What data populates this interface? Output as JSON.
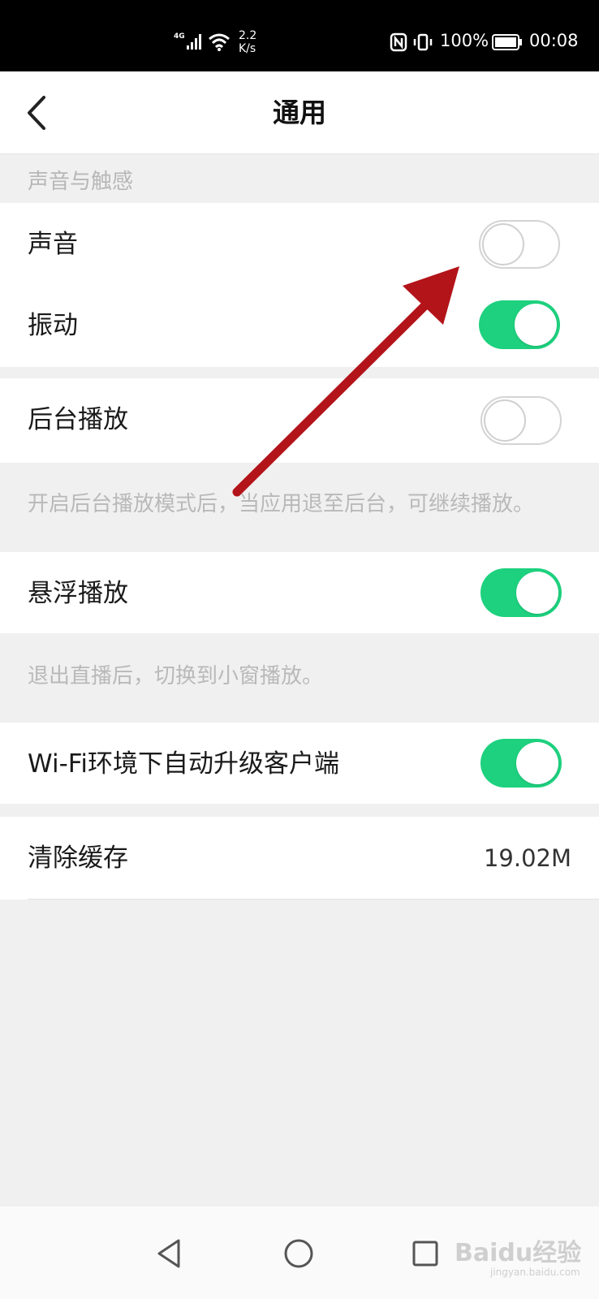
{
  "status_bar": {
    "network": "4G",
    "speed_value": "2.2",
    "speed_unit": "K/s",
    "battery_percent": "100%",
    "time": "00:08"
  },
  "nav": {
    "title": "通用",
    "back_icon": "chevron-left-icon"
  },
  "sections": {
    "sound_haptics": {
      "header": "声音与触感",
      "items": [
        {
          "label": "声音",
          "enabled": false
        },
        {
          "label": "振动",
          "enabled": true
        }
      ]
    },
    "background_play": {
      "label": "后台播放",
      "enabled": false,
      "description": "开启后台播放模式后，当应用退至后台，可继续播放。"
    },
    "floating_play": {
      "label": "悬浮播放",
      "enabled": true,
      "description": "退出直播后，切换到小窗播放。"
    },
    "wifi_upgrade": {
      "label": "Wi-Fi环境下自动升级客户端",
      "enabled": true
    },
    "clear_cache": {
      "label": "清除缓存",
      "value": "19.02M"
    }
  },
  "colors": {
    "toggle_on": "#1dd17e",
    "annotation_arrow": "#b3141a"
  },
  "system_nav": {
    "buttons": [
      "back-triangle-icon",
      "home-circle-icon",
      "recents-square-icon"
    ]
  },
  "watermark": {
    "text": "Baidu经验",
    "sub": "jingyan.baidu.com"
  }
}
